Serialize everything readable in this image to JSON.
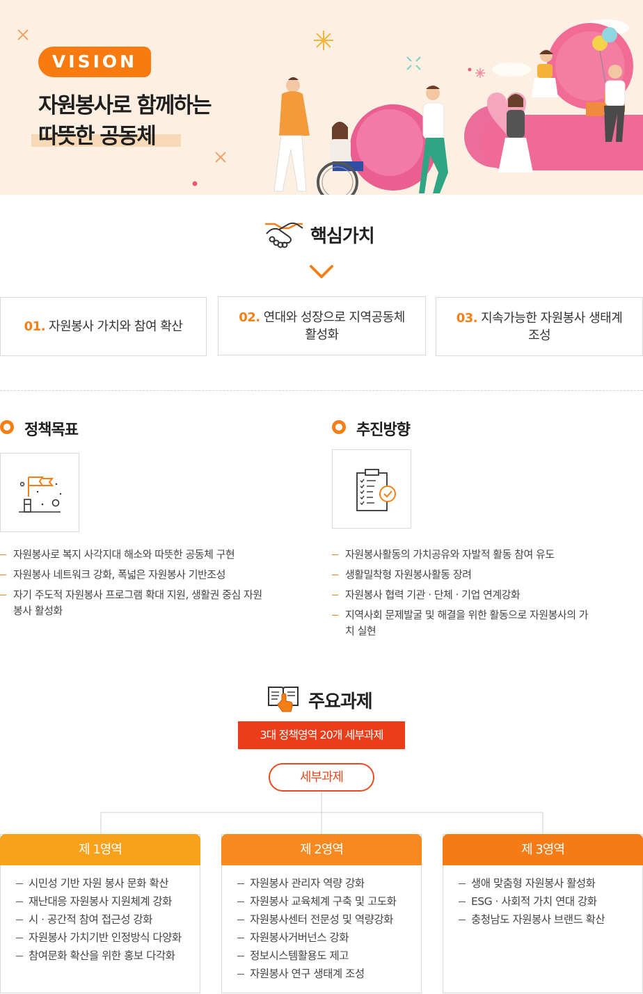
{
  "hero": {
    "badge": "VISION",
    "title_line1": "자원봉사로 함께하는",
    "title_line2": "따뜻한 공동체"
  },
  "core_values": {
    "title": "핵심가치",
    "icon": "handshake-icon",
    "items": [
      {
        "num": "01.",
        "text": "자원봉사 가치와 참여 확산"
      },
      {
        "num": "02.",
        "text": "연대와 성장으로 지역공동체 활성화"
      },
      {
        "num": "03.",
        "text": "지속가능한 자원봉사 생태계 조성"
      }
    ]
  },
  "policy_goals": {
    "title": "정책목표",
    "icon": "flag-icon",
    "items": [
      "자원봉사로 복지 사각지대 해소와 따뜻한 공동체 구현",
      "자원봉사 네트워크 강화, 폭넓은 자원봉사 기반조성",
      "자기 주도적 자원봉사 프로그램 확대 지원, 생활권 중심 자원봉사 활성화"
    ]
  },
  "directions": {
    "title": "추진방향",
    "icon": "checklist-icon",
    "items": [
      "자원봉사활동의 가치공유와 자발적 활동 참여 유도",
      "생활밀착형 자원봉사활동 장려",
      "자원봉사 협력 기관 · 단체 · 기업 연계강화",
      "지역사회 문제발굴 및 해결을 위한 활동으로 자원봉사의 가치 실현"
    ]
  },
  "main_tasks": {
    "title": "주요과제",
    "icon": "book-pointer-icon",
    "banner": "3대 정책영역 20개 세부과제",
    "pill": "세부과제",
    "areas": [
      {
        "title": "제 1영역",
        "color": "#f9a11b",
        "items": [
          "시민성 기반 자원 봉사 문화 확산",
          "재난대응 자원봉사 지원체계 강화",
          "시 · 공간적 참여 접근성 강화",
          "자원봉사 가치기반 인정방식 다양화",
          "참여문화 확산을 위한 홍보 다각화"
        ]
      },
      {
        "title": "제 2영역",
        "color": "#f7891e",
        "items": [
          "자원봉사 관리자 역량 강화",
          "자원봉사 교육체계 구축 및 고도화",
          "자원봉사센터 전문성 및 역량강화",
          "자원봉사거버넌스 강화",
          "정보시스템활용도 제고",
          "자원봉사 연구 생태계 조성"
        ]
      },
      {
        "title": "제 3영역",
        "color": "#f47b16",
        "items": [
          "생애 맞춤형 자원봉사 활성화",
          "ESG · 사회적 가치 연대 강화",
          "충청남도 자원봉사 브랜드 확산"
        ]
      }
    ]
  },
  "colors": {
    "accent": "#f57f17",
    "banner": "#ec3d1a",
    "hero_bg": "#fdf0e2"
  }
}
